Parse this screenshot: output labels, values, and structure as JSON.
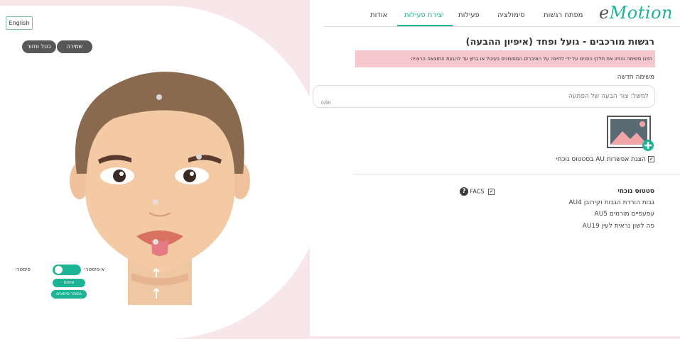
{
  "language_button": "English",
  "actions": {
    "save": "שמירה",
    "cancel": "בטל וחזור"
  },
  "nav": {
    "logo_prefix": "e",
    "logo_main": "Motion",
    "items": [
      "מפתח רגשות",
      "סימולציה",
      "פעילות",
      "יצירת פעילות",
      "אודות"
    ],
    "active_index": 3
  },
  "page": {
    "title": "רגשות מורכבים - גועל ופחד (איפיון ההבעה)",
    "banner": "הזינו משימה והזיזו את חלקי הפנים על ידי לחיצה על האיברים המסומנים בעיגול או בחץ עד להגעת התוצאה הרצויה",
    "new_task_label": "משימה חדשה",
    "input_placeholder": "למשל: צור הבעה של הפתעה",
    "counter": "0/90",
    "show_au_label": "הצגת אפשרות AU בסטטוס נוכחי"
  },
  "status": {
    "title": "סטטוס נוכחי",
    "items": [
      "גבות הורדת הגבות וקירובן AU4",
      "עפעפיים מורמים AU5",
      "פה לשון נראית לעין AU19"
    ],
    "facs_label": "FACS"
  },
  "controls": {
    "symmetric": "סימטרי",
    "asymmetric": "א-סימטרי",
    "reset": "איפוס",
    "hide_markers": "הסתר סימונים"
  },
  "colors": {
    "accent": "#1db495",
    "banner": "#f6c7cd",
    "dark_button": "#575757"
  }
}
